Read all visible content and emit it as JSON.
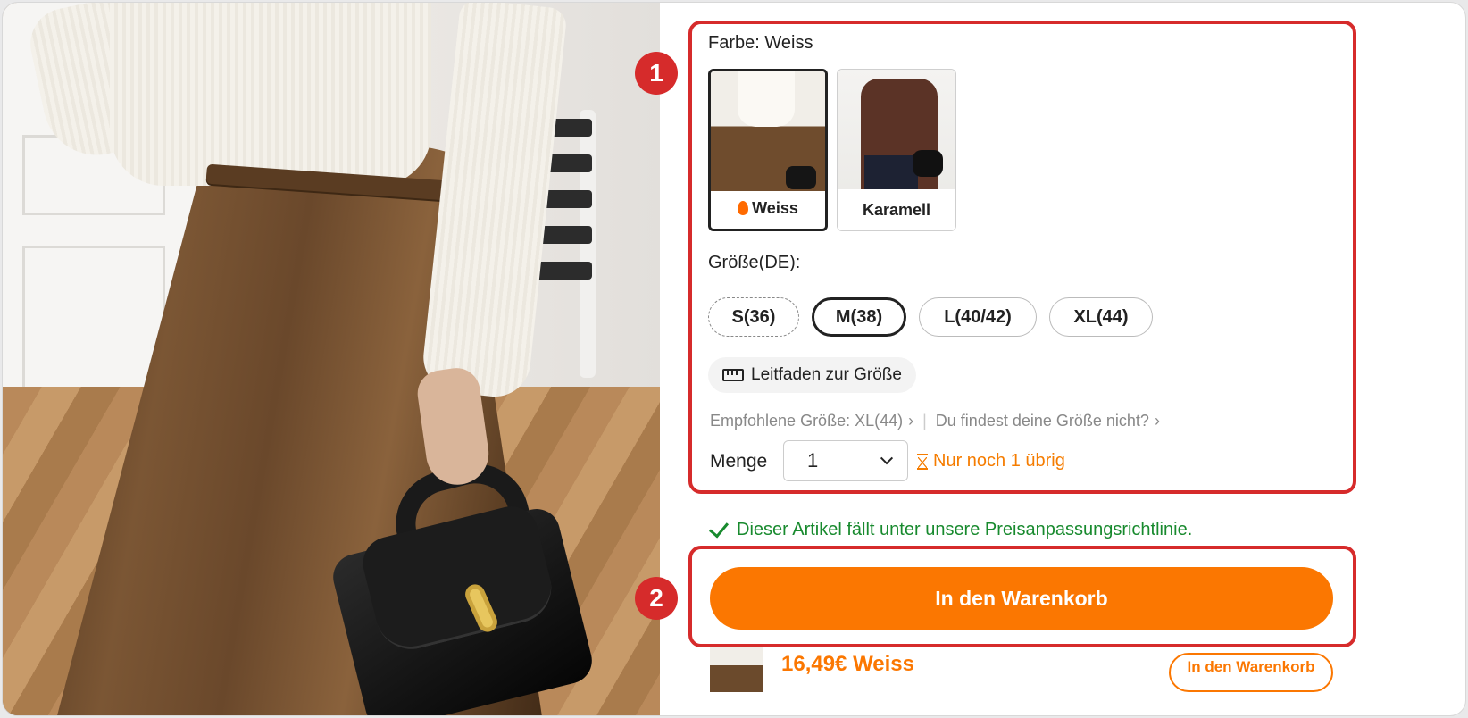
{
  "color": {
    "label": "Farbe: Weiss",
    "options": [
      {
        "name": "Weiss",
        "selected": true,
        "hot": true
      },
      {
        "name": "Karamell",
        "selected": false,
        "hot": false
      }
    ]
  },
  "size": {
    "label": "Größe(DE):",
    "options": [
      {
        "name": "S(36)",
        "state": "unavailable"
      },
      {
        "name": "M(38)",
        "state": "selected"
      },
      {
        "name": "L(40/42)",
        "state": "available"
      },
      {
        "name": "XL(44)",
        "state": "available"
      }
    ],
    "guide_label": "Leitfaden zur Größe",
    "recommended": "Empfohlene Größe: XL(44)",
    "not_found": "Du findest deine Größe nicht?"
  },
  "quantity": {
    "label": "Menge",
    "value": "1",
    "stock_note": "Nur noch 1 übrig"
  },
  "price_policy": "Dieser Artikel fällt unter unsere Preisanpassungsrichtlinie.",
  "cart_button": "In den Warenkorb",
  "sticky_bar": {
    "price_variant": "16,49€  Weiss",
    "button": "In den Warenkorb"
  },
  "annotations": {
    "marker_1": "1",
    "marker_2": "2"
  },
  "colors": {
    "accent": "#fb7701",
    "highlight": "#d62b2b",
    "success": "#188a2e",
    "stock_warning": "#f57c00"
  },
  "icons": [
    "flame-icon",
    "ruler-icon",
    "chevron-down-icon",
    "hourglass-icon",
    "checkmark-icon",
    "chevron-right-icon"
  ]
}
